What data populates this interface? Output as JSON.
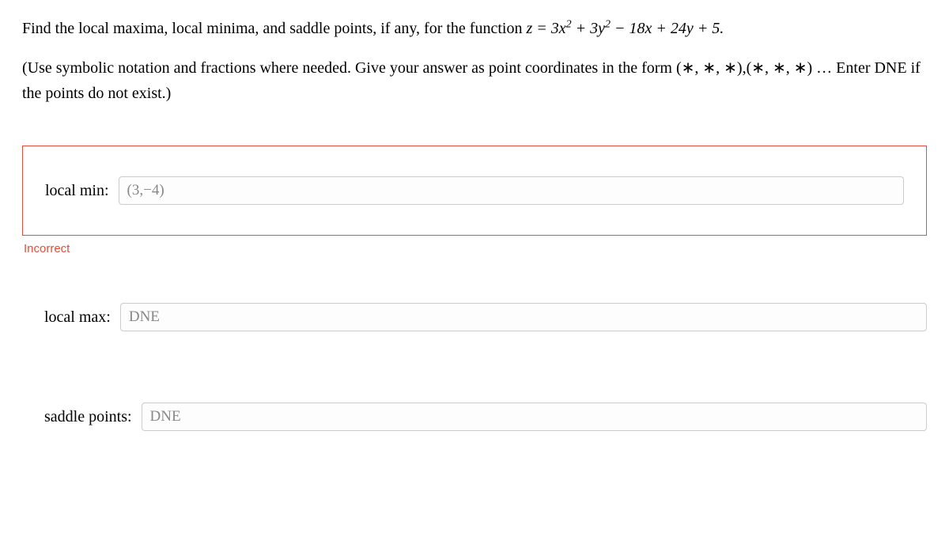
{
  "problem": {
    "prefix": "Find the local maxima, local minima, and saddle points, if any, for the function ",
    "equation_html": "z = 3x² + 3y² − 18x + 24y + 5."
  },
  "instructions": "(Use symbolic notation and fractions where needed. Give your answer as point coordinates in the form (∗, ∗, ∗),(∗, ∗, ∗) … Enter DNE if the points do not exist.)",
  "fields": {
    "local_min": {
      "label": "local min:",
      "value": "(3,−4)",
      "feedback": "Incorrect"
    },
    "local_max": {
      "label": "local max:",
      "value": "DNE"
    },
    "saddle": {
      "label": "saddle points:",
      "value": "DNE"
    }
  }
}
